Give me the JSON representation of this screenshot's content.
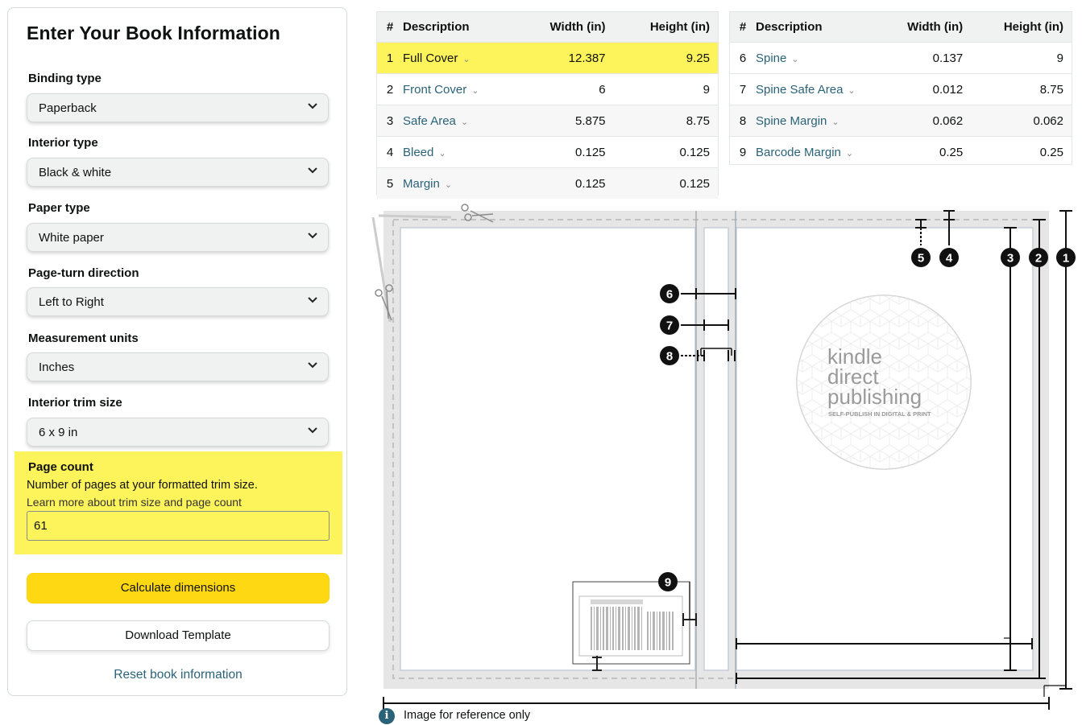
{
  "panel": {
    "title": "Enter Your Book Information",
    "fields": [
      {
        "label": "Binding type",
        "value": "Paperback"
      },
      {
        "label": "Interior type",
        "value": "Black & white"
      },
      {
        "label": "Paper type",
        "value": "White paper"
      },
      {
        "label": "Page-turn direction",
        "value": "Left to Right"
      },
      {
        "label": "Measurement units",
        "value": "Inches"
      },
      {
        "label": "Interior trim size",
        "value": "6 x 9 in"
      }
    ],
    "page_count": {
      "label": "Page count",
      "description": "Number of pages at your formatted trim size.",
      "link": "Learn more about trim size and page count",
      "value": "61"
    },
    "calculate_label": "Calculate dimensions",
    "download_label": "Download Template",
    "reset_label": "Reset book information"
  },
  "table_left": {
    "headers": [
      "#",
      "Description",
      "Width (in)",
      "Height (in)"
    ],
    "rows": [
      {
        "num": "1",
        "desc": "Full Cover",
        "width": "12.387",
        "height": "9.25"
      },
      {
        "num": "2",
        "desc": "Front Cover",
        "width": "6",
        "height": "9"
      },
      {
        "num": "3",
        "desc": "Safe Area",
        "width": "5.875",
        "height": "8.75"
      },
      {
        "num": "4",
        "desc": "Bleed",
        "width": "0.125",
        "height": "0.125"
      },
      {
        "num": "5",
        "desc": "Margin",
        "width": "0.125",
        "height": "0.125"
      }
    ]
  },
  "table_right": {
    "headers": [
      "#",
      "Description",
      "Width (in)",
      "Height (in)"
    ],
    "rows": [
      {
        "num": "6",
        "desc": "Spine",
        "width": "0.137",
        "height": "9"
      },
      {
        "num": "7",
        "desc": "Spine Safe Area",
        "width": "0.012",
        "height": "8.75"
      },
      {
        "num": "8",
        "desc": "Spine Margin",
        "width": "0.062",
        "height": "0.062"
      },
      {
        "num": "9",
        "desc": "Barcode Margin",
        "width": "0.25",
        "height": "0.25"
      }
    ]
  },
  "diagram": {
    "markers": [
      "1",
      "2",
      "3",
      "4",
      "5",
      "6",
      "7",
      "8",
      "9"
    ],
    "logo": {
      "line1": "kindle",
      "line2": "direct",
      "line3": "publishing",
      "tagline": "SELF-PUBLISH IN DIGITAL & PRINT"
    }
  },
  "info_icon": "info-icon",
  "info_text": "Image for reference only",
  "colors": {
    "highlight": "#fdf35a",
    "primary_button": "#ffd814",
    "link": "#2a6378"
  }
}
